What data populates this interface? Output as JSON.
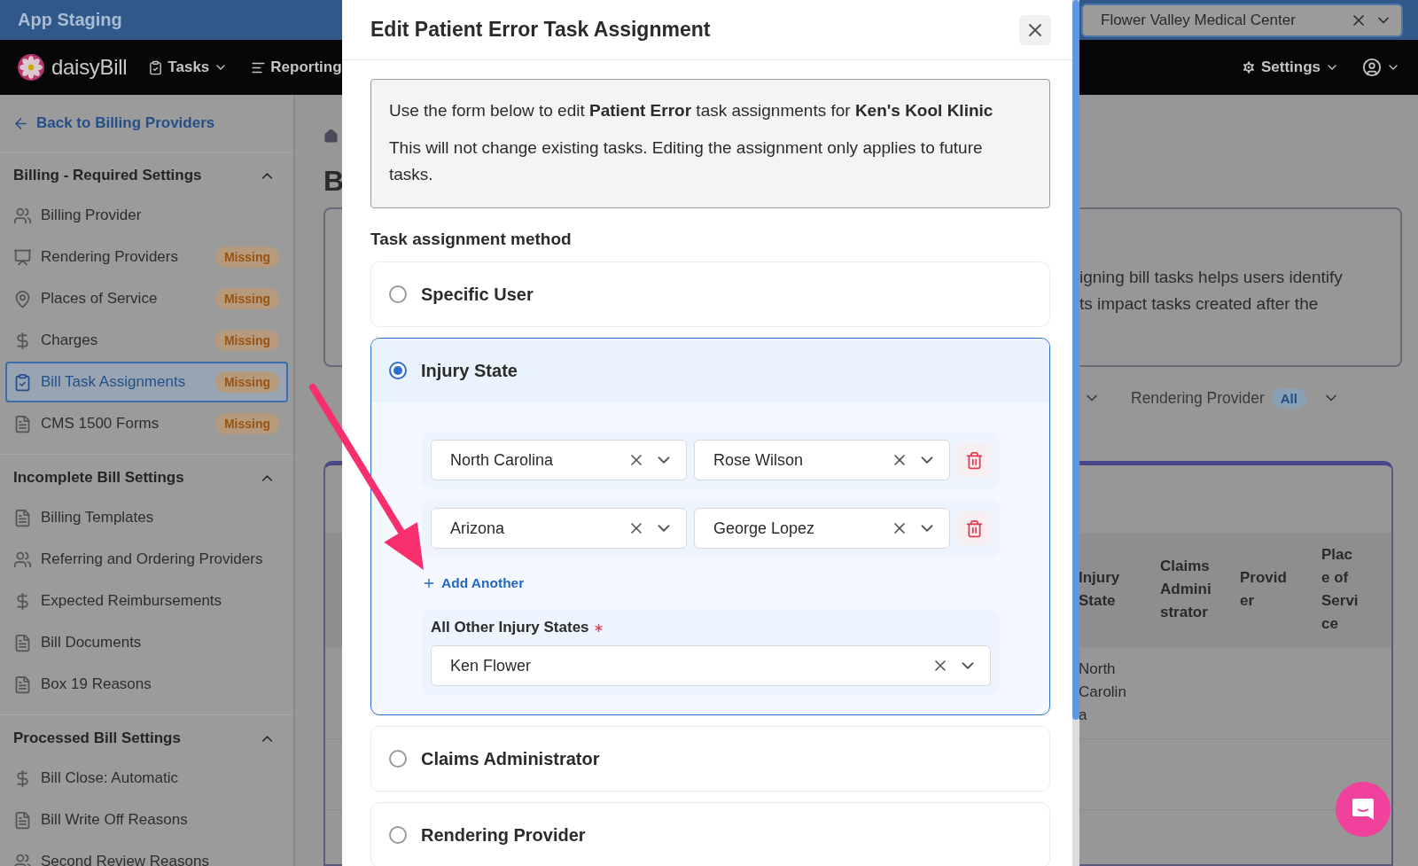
{
  "top_bar": {
    "title": "App Staging",
    "facility": {
      "value": "Flower Valley Medical Center"
    }
  },
  "nav": {
    "brand": "daisyBill",
    "menus": [
      "Tasks",
      "Reporting"
    ],
    "settings": "Settings"
  },
  "sidebar": {
    "back_link": "Back to Billing Providers",
    "sections": [
      {
        "title": "Billing - Required Settings",
        "expanded": true,
        "items": [
          {
            "label": "Billing Provider",
            "selected": false
          },
          {
            "label": "Rendering Providers",
            "badge": "Missing",
            "selected": false
          },
          {
            "label": "Places of Service",
            "badge": "Missing",
            "selected": false
          },
          {
            "label": "Charges",
            "badge": "Missing",
            "selected": false
          },
          {
            "label": "Bill Task Assignments",
            "badge": "Missing",
            "selected": true
          },
          {
            "label": "CMS 1500 Forms",
            "badge": "Missing",
            "selected": false
          }
        ]
      },
      {
        "title": "Incomplete Bill Settings",
        "expanded": true,
        "items": [
          {
            "label": "Billing Templates",
            "selected": false
          },
          {
            "label": "Referring and Ordering Providers",
            "selected": false
          },
          {
            "label": "Expected Reimbursements",
            "selected": false
          },
          {
            "label": "Bill Documents",
            "selected": false
          },
          {
            "label": "Box 19 Reasons",
            "selected": false
          }
        ]
      },
      {
        "title": "Processed Bill Settings",
        "expanded": true,
        "items": [
          {
            "label": "Bill Close: Automatic",
            "selected": false
          },
          {
            "label": "Bill Write Off Reasons",
            "selected": false
          },
          {
            "label": "Second Review Reasons",
            "selected": false
          }
        ]
      }
    ]
  },
  "main": {
    "heading": "B",
    "card_lines": [
      "igning bill tasks helps users identify",
      "ts impact tasks created after the"
    ],
    "filter": {
      "label": "Rendering Provider",
      "badge": "All"
    },
    "table": {
      "columns": [
        "Injury State",
        "Claims Administrator",
        "Provider",
        "Place of Service"
      ],
      "rows": [
        {
          "injury_state": "North Carolina"
        }
      ]
    }
  },
  "modal": {
    "title": "Edit Patient Error Task Assignment",
    "info": [
      "Use the form below to edit **Patient Error** task assignments for **Ken's Kool Klinic**",
      "This will not change existing tasks. Editing the assignment only applies to future tasks."
    ],
    "method_label": "Task assignment method",
    "options": [
      {
        "label": "Specific User",
        "selected": false
      },
      {
        "label": "Injury State",
        "selected": true,
        "rules": [
          {
            "state": "North Carolina",
            "user": "Rose Wilson"
          },
          {
            "state": "Arizona",
            "user": "George Lopez"
          }
        ],
        "add_label": "Add Another",
        "fallback": {
          "label": "All Other Injury States",
          "required": true,
          "value": "Ken Flower"
        }
      },
      {
        "label": "Claims Administrator",
        "selected": false
      },
      {
        "label": "Rendering Provider",
        "selected": false
      }
    ]
  }
}
